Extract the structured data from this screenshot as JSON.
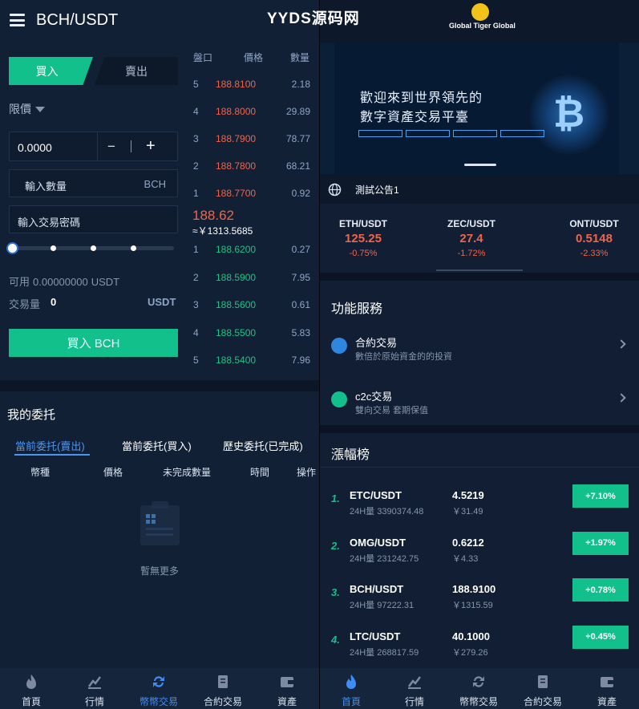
{
  "watermark": "YYDS源码网",
  "left": {
    "header": {
      "title": "BCH/USDT"
    },
    "trade": {
      "buy_tab": "買入",
      "sell_tab": "賣出",
      "order_type": "限價",
      "price_value": "0.0000",
      "minus": "−",
      "plus": "+",
      "qty_label": "輸入數量",
      "qty_unit": "BCH",
      "password_placeholder": "輸入交易密碼",
      "slider_fraction": 0,
      "available_label": "可用",
      "available_value": "0.00000000",
      "available_unit": "USDT",
      "volume_label": "交易量",
      "volume_value": "0",
      "volume_unit": "USDT",
      "buy_button": "買入 BCH"
    },
    "orderbook": {
      "headers": [
        "盤口",
        "價格",
        "數量"
      ],
      "asks": [
        {
          "level": "5",
          "price": "188.8100",
          "amount": "2.18"
        },
        {
          "level": "4",
          "price": "188.8000",
          "amount": "29.89"
        },
        {
          "level": "3",
          "price": "188.7900",
          "amount": "78.77"
        },
        {
          "level": "2",
          "price": "188.7800",
          "amount": "68.21"
        },
        {
          "level": "1",
          "price": "188.7700",
          "amount": "0.92"
        }
      ],
      "last_price": "188.62",
      "last_cny": "≈￥1313.5685",
      "bids": [
        {
          "level": "1",
          "price": "188.6200",
          "amount": "0.27"
        },
        {
          "level": "2",
          "price": "188.5900",
          "amount": "7.95"
        },
        {
          "level": "3",
          "price": "188.5600",
          "amount": "0.61"
        },
        {
          "level": "4",
          "price": "188.5500",
          "amount": "5.83"
        },
        {
          "level": "5",
          "price": "188.5400",
          "amount": "7.96"
        }
      ]
    },
    "orders": {
      "title": "我的委托",
      "tabs": [
        "當前委托(賣出)",
        "當前委托(買入)",
        "歷史委托(已完成)"
      ],
      "columns": [
        "幣種",
        "價格",
        "未完成數量",
        "時間",
        "操作"
      ],
      "empty": "暫無更多"
    }
  },
  "nav": [
    "首頁",
    "行情",
    "幣幣交易",
    "合約交易",
    "資產"
  ],
  "right": {
    "logo_text": "Global Tiger Global",
    "banner": {
      "line1": "歡迎來到世界領先的",
      "line2": "數字資產交易平臺",
      "coin_symbol": "₿"
    },
    "notice": "測試公告1",
    "tickers": [
      {
        "pair": "ETH/USDT",
        "price": "125.25",
        "change": "-0.75%"
      },
      {
        "pair": "ZEC/USDT",
        "price": "27.4",
        "change": "-1.72%"
      },
      {
        "pair": "ONT/USDT",
        "price": "0.5148",
        "change": "-2.33%"
      }
    ],
    "services": {
      "title": "功能服務",
      "items": [
        {
          "name": "合約交易",
          "desc": "數倍於原始資金的的投資"
        },
        {
          "name": "c2c交易",
          "desc": "雙向交易 套期保值"
        }
      ]
    },
    "gainers": {
      "title": "漲幅榜",
      "rows": [
        {
          "rank": "1.",
          "pair": "ETC/USDT",
          "vol": "24H量 3390374.48",
          "price": "4.5219",
          "cny": "￥31.49",
          "change": "+7.10%"
        },
        {
          "rank": "2.",
          "pair": "OMG/USDT",
          "vol": "24H量 231242.75",
          "price": "0.6212",
          "cny": "￥4.33",
          "change": "+1.97%"
        },
        {
          "rank": "3.",
          "pair": "BCH/USDT",
          "vol": "24H量 97222.31",
          "price": "188.9100",
          "cny": "￥1315.59",
          "change": "+0.78%"
        },
        {
          "rank": "4.",
          "pair": "LTC/USDT",
          "vol": "24H量 268817.59",
          "price": "40.1000",
          "cny": "￥279.26",
          "change": "+0.45%"
        }
      ]
    }
  },
  "colors": {
    "up": "#12c08b",
    "down": "#f0654a",
    "accent": "#3d8df5"
  }
}
